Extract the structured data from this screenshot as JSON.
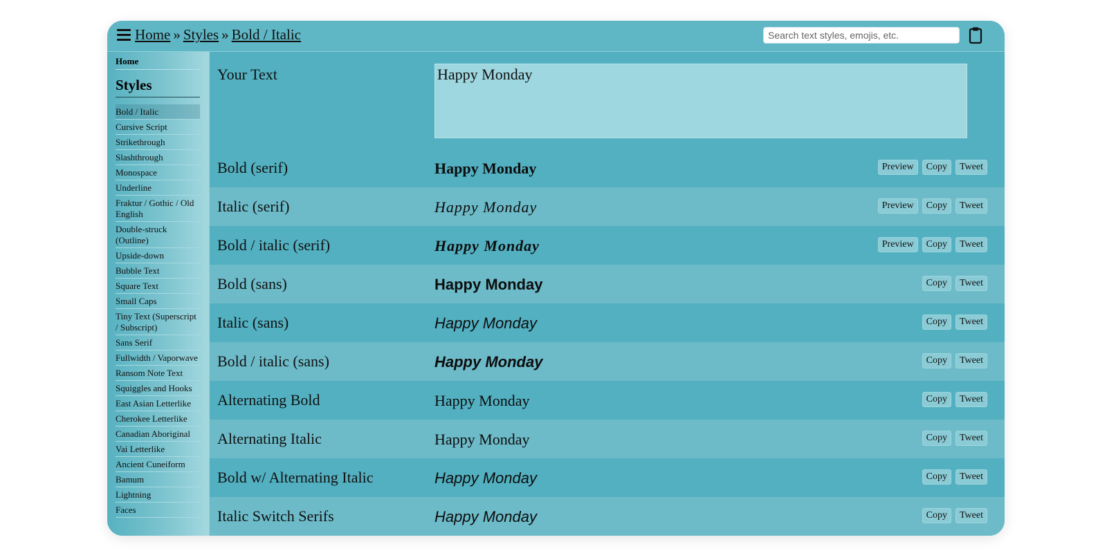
{
  "header": {
    "breadcrumb": [
      "Home",
      "Styles",
      "Bold / Italic"
    ],
    "separator": "»",
    "search_placeholder": "Search text styles, emojis, etc."
  },
  "sidebar": {
    "home": "Home",
    "styles_heading": "Styles",
    "items": [
      "Bold / Italic",
      "Cursive Script",
      "Strikethrough",
      "Slashthrough",
      "Monospace",
      "Underline",
      "Fraktur / Gothic / Old English",
      "Double-struck (Outline)",
      "Upside-down",
      "Bubble Text",
      "Square Text",
      "Small Caps",
      "Tiny Text (Superscript / Subscript)",
      "Sans Serif",
      "Fullwidth / Vaporwave",
      "Ransom Note Text",
      "Squiggles and Hooks",
      "East Asian Letterlike",
      "Cherokee Letterlike",
      "Canadian Aboriginal",
      "Vai Letterlike",
      "Ancient Cuneiform",
      "Bamum",
      "Lightning",
      "Faces"
    ],
    "active_index": 0
  },
  "input": {
    "label": "Your Text",
    "value": "Happy Monday"
  },
  "buttons": {
    "preview": "Preview",
    "copy": "Copy",
    "tweet": "Tweet"
  },
  "rows": [
    {
      "label": "Bold (serif)",
      "output": "Happy Monday",
      "preview": true
    },
    {
      "label": "Italic (serif)",
      "output": "Happy Monday",
      "preview": true
    },
    {
      "label": "Bold / italic (serif)",
      "output": "Happy Monday",
      "preview": true
    },
    {
      "label": "Bold (sans)",
      "output": "Happy Monday",
      "preview": false
    },
    {
      "label": "Italic (sans)",
      "output": "Happy Monday",
      "preview": false
    },
    {
      "label": "Bold / italic (sans)",
      "output": "Happy Monday",
      "preview": false
    },
    {
      "label": "Alternating Bold",
      "output": "Happy Monday",
      "preview": false
    },
    {
      "label": "Alternating Italic",
      "output": "Happy Monday",
      "preview": false
    },
    {
      "label": "Bold w/ Alternating Italic",
      "output": "Happy Monday",
      "preview": false
    },
    {
      "label": "Italic Switch Serifs",
      "output": "Happy Monday",
      "preview": false
    }
  ],
  "colors": {
    "row_dark": "#52b0c1",
    "row_light": "#6dbbc9",
    "input_bg": "#9fd7e0"
  }
}
